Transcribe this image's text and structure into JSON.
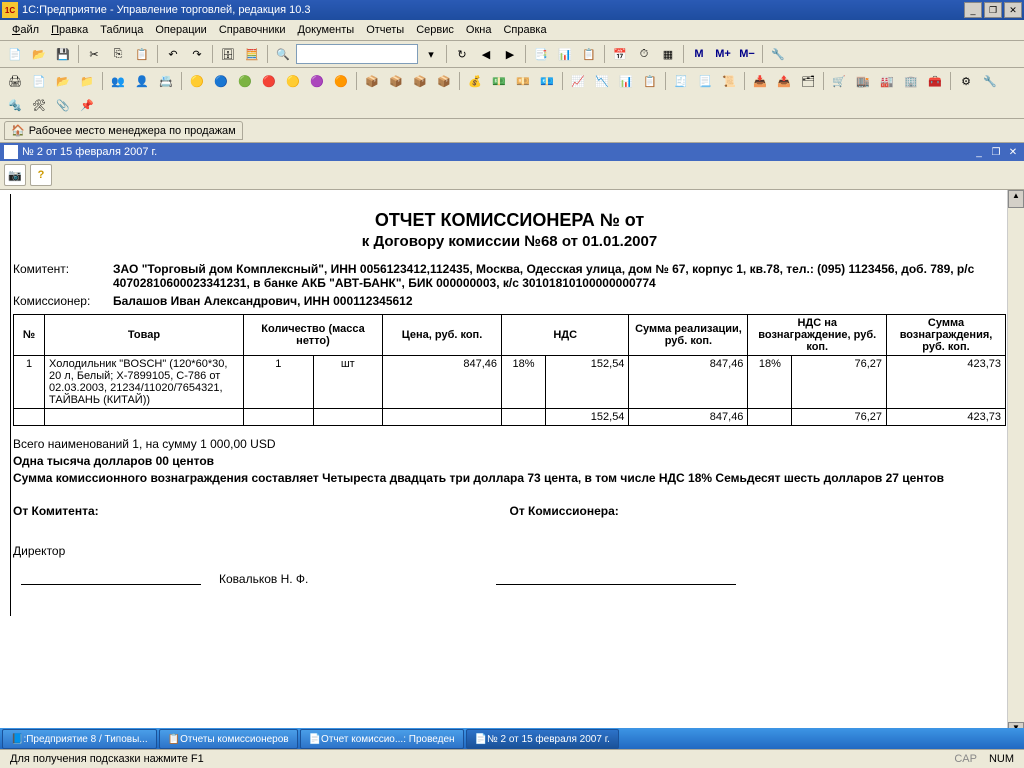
{
  "app": {
    "title": "1С:Предприятие - Управление торговлей, редакция 10.3"
  },
  "menu": {
    "file": "Файл",
    "edit": "Правка",
    "table": "Таблица",
    "operations": "Операции",
    "catalogs": "Справочники",
    "documents": "Документы",
    "reports": "Отчеты",
    "service": "Сервис",
    "windows": "Окна",
    "help": "Справка"
  },
  "tab": {
    "label": "Рабочее место менеджера по продажам"
  },
  "doc": {
    "title": "№ 2 от 15 февраля 2007 г."
  },
  "report": {
    "title": "ОТЧЕТ КОМИССИОНЕРА №  от",
    "subtitle": "к Договору комиссии №68 от 01.01.2007",
    "komitent_label": "Комитент:",
    "komitent": "ЗАО \"Торговый дом Комплексный\", ИНН 0056123412,112435, Москва, Одесская улица, дом № 67, корпус 1, кв.78, тел.: (095) 1123456, доб. 789, р/с 40702810600023341231, в банке АКБ \"АВТ-БАНК\", БИК 000000003, к/с 30101810100000000774",
    "komissioner_label": "Комиссионер:",
    "komissioner": "Балашов Иван Александрович, ИНН 000112345612",
    "headers": {
      "no": "№",
      "product": "Товар",
      "qty": "Количество (масса нетто)",
      "price": "Цена, руб. коп.",
      "vat": "НДС",
      "sum_real": "Сумма реализации, руб. коп.",
      "vat_reward": "НДС на вознаграждение, руб. коп.",
      "sum_reward": "Сумма вознаграждения, руб. коп."
    },
    "row": {
      "no": "1",
      "product": "Холодильник \"BOSCH\" (120*60*30, 20 л, Белый; Х-7899105, С-786 от 02.03.2003, 21234/11020/7654321, ТАЙВАНЬ (КИТАЙ))",
      "qty": "1",
      "unit": "шт",
      "price": "847,46",
      "vat_pct": "18%",
      "vat_sum": "152,54",
      "sum_real": "847,46",
      "vat_reward_pct": "18%",
      "vat_reward_sum": "76,27",
      "sum_reward": "423,73"
    },
    "totals_row": {
      "vat_sum": "152,54",
      "sum_real": "847,46",
      "vat_reward": "76,27",
      "sum_reward": "423,73"
    },
    "summary1": "Всего наименований 1, на сумму 1 000,00 USD",
    "summary2": "Одна тысяча долларов 00 центов",
    "summary3": "Сумма комиссионного вознаграждения составляет Четыреста двадцать три доллара 73 цента, в том числе НДС 18% Семьдесят шесть долларов 27 центов",
    "from_komitent": "От Комитента:",
    "from_komissioner": "От Комиссионера:",
    "director": "Директор",
    "signer": "Ковальков  Н. Ф."
  },
  "taskbar": {
    "t1": ":Предприятие 8 / Типовы...",
    "t2": "Отчеты комиссионеров",
    "t3": "Отчет комиссио...: Проведен",
    "t4": "№ 2 от 15 февраля 2007 г."
  },
  "status": {
    "hint": "Для получения подсказки нажмите F1",
    "cap": "CAP",
    "num": "NUM"
  }
}
